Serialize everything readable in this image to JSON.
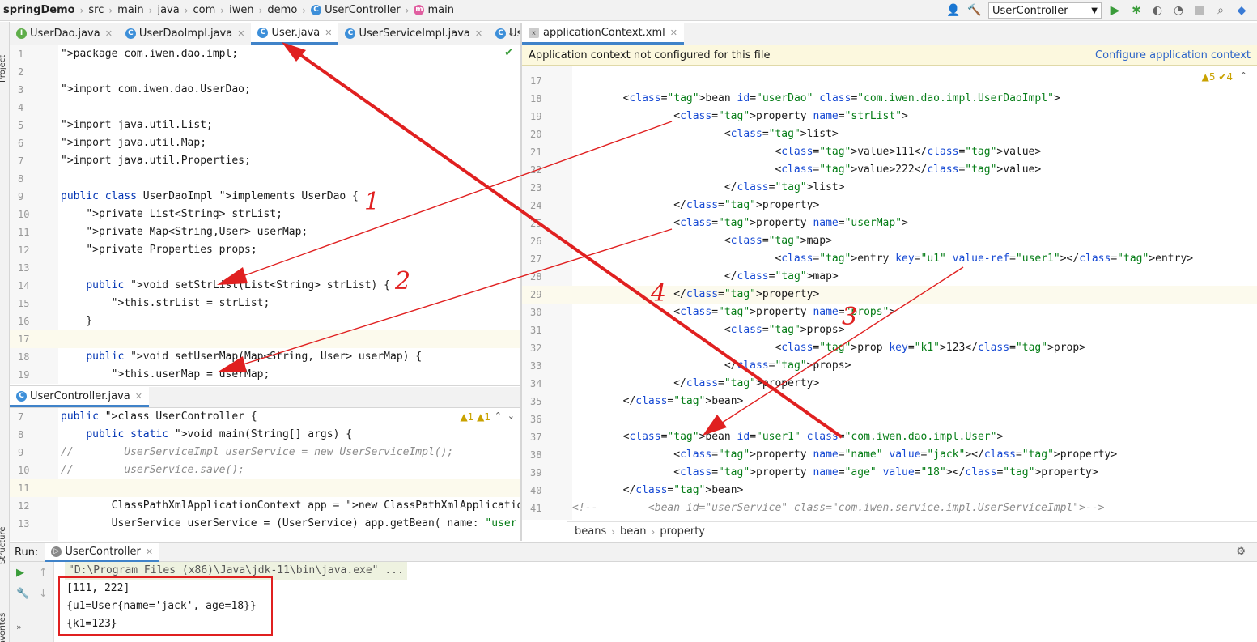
{
  "nav": {
    "project": "springDemo",
    "crumbs": [
      "src",
      "main",
      "java",
      "com",
      "iwen",
      "demo",
      "UserController",
      "main"
    ],
    "run_config": "UserController"
  },
  "left_stripe": {
    "project": "Project",
    "structure": "Structure",
    "favorites": "Favorites"
  },
  "left_tabs": [
    "UserDao.java",
    "UserDaoImpl.java",
    "User.java",
    "UserServiceImpl.java",
    "Use"
  ],
  "right_tab": "applicationContext.xml",
  "bottom_left_tab": "UserController.java",
  "daoimpl_lines": [
    {
      "n": "1",
      "t": "package com.iwen.dao.impl;"
    },
    {
      "n": "2",
      "t": ""
    },
    {
      "n": "3",
      "t": "import com.iwen.dao.UserDao;"
    },
    {
      "n": "4",
      "t": ""
    },
    {
      "n": "5",
      "t": "import java.util.List;"
    },
    {
      "n": "6",
      "t": "import java.util.Map;"
    },
    {
      "n": "7",
      "t": "import java.util.Properties;"
    },
    {
      "n": "8",
      "t": ""
    },
    {
      "n": "9",
      "t": "public class UserDaoImpl implements UserDao {"
    },
    {
      "n": "10",
      "t": "    private List<String> strList;"
    },
    {
      "n": "11",
      "t": "    private Map<String,User> userMap;"
    },
    {
      "n": "12",
      "t": "    private Properties props;"
    },
    {
      "n": "13",
      "t": ""
    },
    {
      "n": "14",
      "t": "    public void setStrList(List<String> strList) {"
    },
    {
      "n": "15",
      "t": "        this.strList = strList;"
    },
    {
      "n": "16",
      "t": "    }"
    },
    {
      "n": "17",
      "t": ""
    },
    {
      "n": "18",
      "t": "    public void setUserMap(Map<String, User> userMap) {"
    },
    {
      "n": "19",
      "t": "        this.userMap = userMap;"
    }
  ],
  "controller_lines": [
    {
      "n": "7",
      "t": "public class UserController {"
    },
    {
      "n": "8",
      "t": "    public static void main(String[] args) {"
    },
    {
      "n": "9",
      "t": "//        UserServiceImpl userService = new UserServiceImpl();"
    },
    {
      "n": "10",
      "t": "//        userService.save();"
    },
    {
      "n": "11",
      "t": ""
    },
    {
      "n": "12",
      "t": "        ClassPathXmlApplicationContext app = new ClassPathXmlApplicatio"
    },
    {
      "n": "13",
      "t": "        UserService userService = (UserService) app.getBean( name: \"user"
    }
  ],
  "controller_inspections": "▲1  ▲1",
  "xml_banner": {
    "message": "Application context not configured for this file",
    "action": "Configure application context"
  },
  "xml_inspections": "▲5  ✔4",
  "xml_lines": [
    {
      "n": "17",
      "t": ""
    },
    {
      "n": "18",
      "t": "        <bean id=\"userDao\" class=\"com.iwen.dao.impl.UserDaoImpl\">"
    },
    {
      "n": "19",
      "t": "                <property name=\"strList\">"
    },
    {
      "n": "20",
      "t": "                        <list>"
    },
    {
      "n": "21",
      "t": "                                <value>111</value>"
    },
    {
      "n": "22",
      "t": "                                <value>222</value>"
    },
    {
      "n": "23",
      "t": "                        </list>"
    },
    {
      "n": "24",
      "t": "                </property>"
    },
    {
      "n": "25",
      "t": "                <property name=\"userMap\">"
    },
    {
      "n": "26",
      "t": "                        <map>"
    },
    {
      "n": "27",
      "t": "                                <entry key=\"u1\" value-ref=\"user1\"></entry>"
    },
    {
      "n": "28",
      "t": "                        </map>"
    },
    {
      "n": "29",
      "t": "                </property>"
    },
    {
      "n": "30",
      "t": "                <property name=\"props\">"
    },
    {
      "n": "31",
      "t": "                        <props>"
    },
    {
      "n": "32",
      "t": "                                <prop key=\"k1\">123</prop>"
    },
    {
      "n": "33",
      "t": "                        </props>"
    },
    {
      "n": "34",
      "t": "                </property>"
    },
    {
      "n": "35",
      "t": "        </bean>"
    },
    {
      "n": "36",
      "t": ""
    },
    {
      "n": "37",
      "t": "        <bean id=\"user1\" class=\"com.iwen.dao.impl.User\">"
    },
    {
      "n": "38",
      "t": "                <property name=\"name\" value=\"jack\"></property>"
    },
    {
      "n": "39",
      "t": "                <property name=\"age\" value=\"18\"></property>"
    },
    {
      "n": "40",
      "t": "        </bean>"
    },
    {
      "n": "41",
      "t": "<!--        <bean id=\"userService\" class=\"com.iwen.service.impl.UserServiceImpl\">-->"
    }
  ],
  "xml_breadcrumb": [
    "beans",
    "bean",
    "property"
  ],
  "run": {
    "label": "Run:",
    "tab": "UserController",
    "command": "\"D:\\Program Files (x86)\\Java\\jdk-11\\bin\\java.exe\" ...",
    "output": [
      "[111, 222]",
      "{u1=User{name='jack', age=18}}",
      "{k1=123}"
    ]
  },
  "annotations": [
    "1",
    "2",
    "3",
    "4"
  ],
  "colors": {
    "keyword": "#0033b3",
    "field": "#871094",
    "string": "#067d17",
    "annotation": "#e02020",
    "tab_underline": "#4083c9"
  }
}
